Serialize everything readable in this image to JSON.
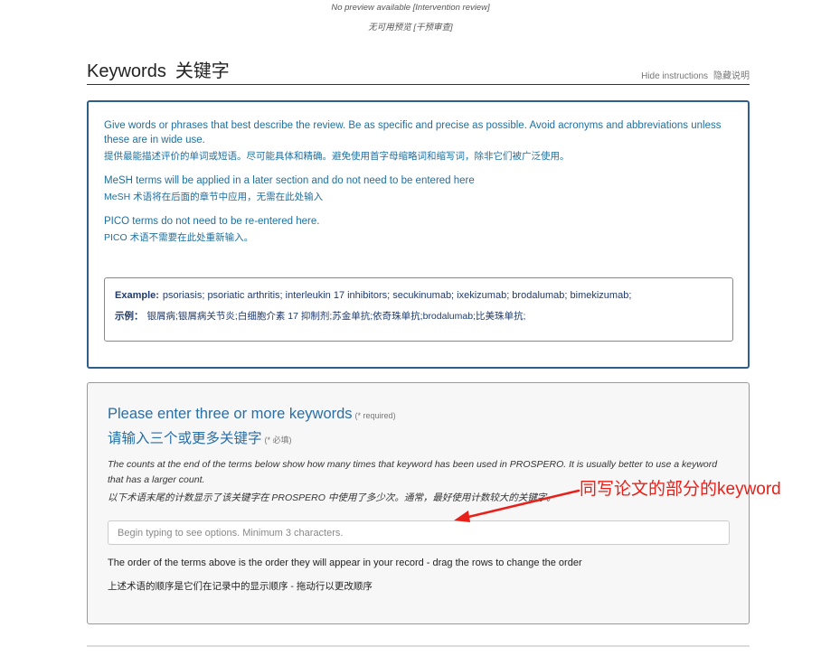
{
  "preview": {
    "en": "No preview available [Intervention review]",
    "zh": "无可用预览 [干预审查]"
  },
  "header": {
    "title_en": "Keywords",
    "title_zh": "关键字",
    "hide_en": "Hide instructions",
    "hide_zh": "隐藏说明"
  },
  "instructions": {
    "p1_en": "Give words or phrases that best describe the review. Be as specific and precise as possible. Avoid acronyms and abbreviations unless these are in wide use.",
    "p1_zh": "提供最能描述评价的单词或短语。尽可能具体和精确。避免使用首字母缩略词和缩写词，除非它们被广泛使用。",
    "p2_en": "MeSH terms will be applied in a later section and do not need to be entered here",
    "p2_zh": "MeSH 术语将在后面的章节中应用，无需在此处输入",
    "p3_en": "PICO terms do not need to be re-entered here.",
    "p3_zh": "PICO 术语不需要在此处重新输入。",
    "example": {
      "label_en": "Example:",
      "text_en": "psoriasis; psoriatic arthritis; interleukin 17 inhibitors; secukinumab; ixekizumab; brodalumab; bimekizumab;",
      "label_zh": "示例：",
      "text_zh": "银屑病;银屑病关节炎;白细胞介素 17 抑制剂;苏金单抗;依奇珠单抗;brodalumab;比美珠单抗;"
    }
  },
  "form": {
    "title_en": "Please enter three or more keywords",
    "required_en": "(* required)",
    "title_zh": "请输入三个或更多关键字",
    "required_zh": "(* 必填)",
    "counts_en": "The counts at the end of the terms below show how many times that keyword has been used in PROSPERO. It is usually better to use a keyword that has a larger count.",
    "counts_zh": "以下术语末尾的计数显示了该关键字在 PROSPERO 中使用了多少次。通常，最好使用计数较大的关键字。",
    "input_placeholder": "Begin typing to see options. Minimum 3 characters.",
    "input_value": "",
    "order_en": "The order of the terms above is the order they will appear in your record - drag the rows to change the order",
    "order_zh": "上述术语的顺序是它们在记录中的显示顺序 - 拖动行以更改顺序"
  },
  "annotation": {
    "text": "同写论文的部分的keyword",
    "color": "#e8201a"
  },
  "colors": {
    "instr_border": "#2e5f8a",
    "instr_text": "#1f6fa0",
    "form_title": "#2a6ea6"
  }
}
